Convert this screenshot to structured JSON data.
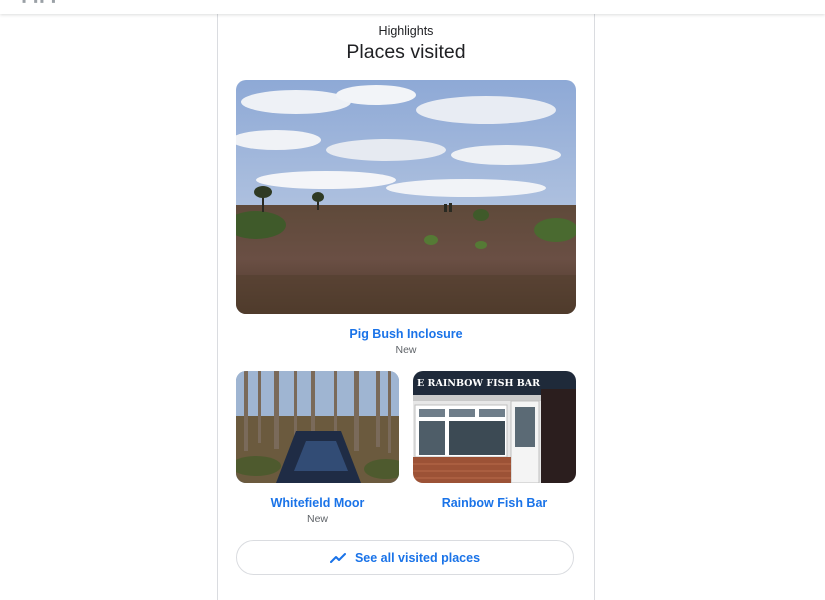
{
  "header": {
    "kicker": "Highlights",
    "title": "Places visited"
  },
  "places": [
    {
      "name": "Pig Bush Inclosure",
      "badge": "New",
      "icon": "heathland-photo"
    },
    {
      "name": "Whitefield Moor",
      "badge": "New",
      "icon": "forest-stream-photo"
    },
    {
      "name": "Rainbow Fish Bar",
      "badge": "",
      "icon": "shopfront-photo",
      "sign_text": "E RAINBOW FISH BAR"
    }
  ],
  "see_all": {
    "label": "See all visited places",
    "icon": "trending-up-icon"
  },
  "colors": {
    "accent": "#1a73e8",
    "text_primary": "#202124",
    "text_secondary": "#5f6368",
    "border": "#dadce0"
  }
}
